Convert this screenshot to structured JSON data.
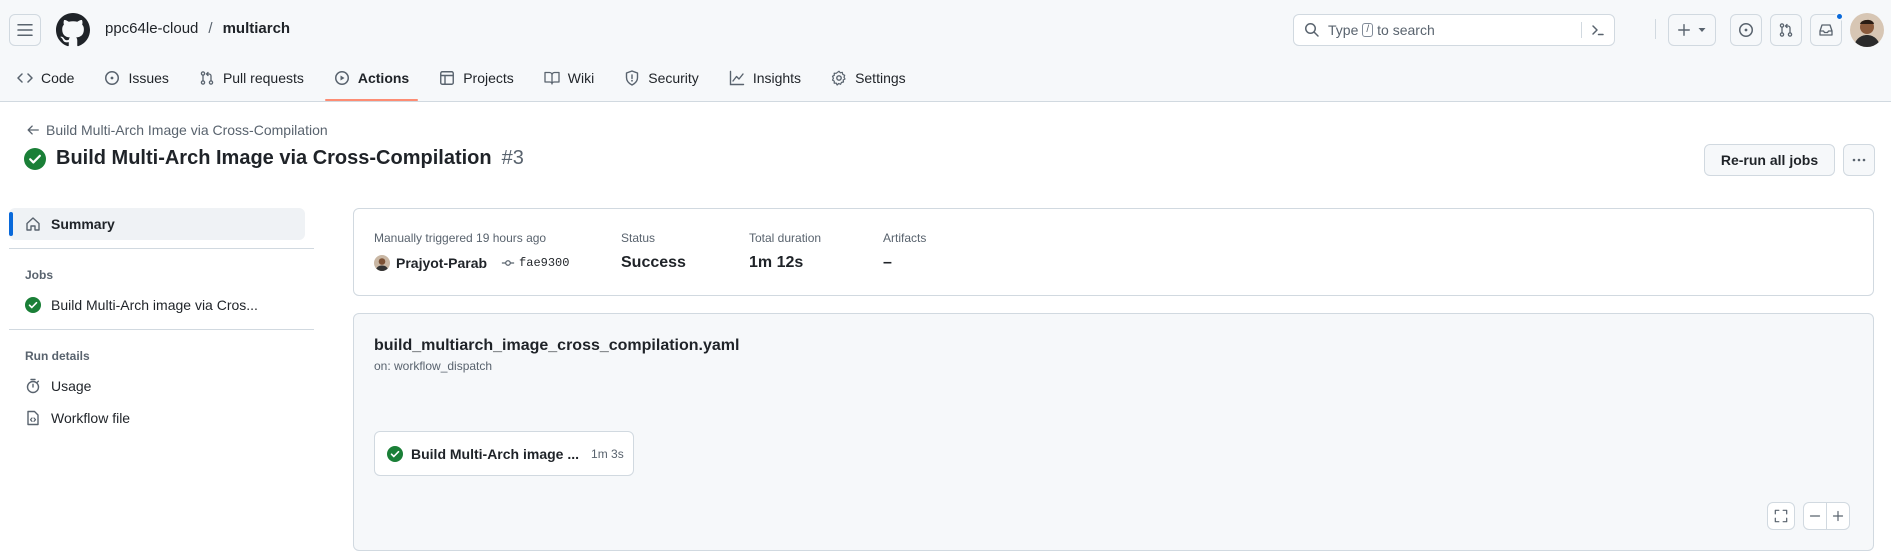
{
  "header": {
    "owner": "ppc64le-cloud",
    "separator": "/",
    "repo": "multiarch",
    "search_prefix": "Type",
    "search_key": "/",
    "search_suffix": "to search"
  },
  "tabs": [
    {
      "label": "Code",
      "icon": "code-icon"
    },
    {
      "label": "Issues",
      "icon": "issue-icon"
    },
    {
      "label": "Pull requests",
      "icon": "pull-request-icon"
    },
    {
      "label": "Actions",
      "icon": "play-icon",
      "active": true
    },
    {
      "label": "Projects",
      "icon": "table-icon"
    },
    {
      "label": "Wiki",
      "icon": "book-icon"
    },
    {
      "label": "Security",
      "icon": "shield-icon"
    },
    {
      "label": "Insights",
      "icon": "graph-icon"
    },
    {
      "label": "Settings",
      "icon": "gear-icon"
    }
  ],
  "run": {
    "back_label": "Build Multi-Arch Image via Cross-Compilation",
    "title": "Build Multi-Arch Image via Cross-Compilation",
    "number": "#3",
    "rerun_label": "Re-run all jobs"
  },
  "sidebar": {
    "summary_label": "Summary",
    "jobs_heading": "Jobs",
    "job_label": "Build Multi-Arch image via Cros...",
    "run_details_heading": "Run details",
    "usage_label": "Usage",
    "workflow_file_label": "Workflow file"
  },
  "summary": {
    "trigger_label": "Manually triggered 19 hours ago",
    "actor": "Prajyot-Parab",
    "commit": "fae9300",
    "status_label": "Status",
    "status_value": "Success",
    "duration_label": "Total duration",
    "duration_value": "1m 12s",
    "artifacts_label": "Artifacts",
    "artifacts_value": "–"
  },
  "graph": {
    "workflow_file": "build_multiarch_image_cross_compilation.yaml",
    "trigger": "on: workflow_dispatch",
    "job_name": "Build Multi-Arch image ...",
    "job_duration": "1m 3s"
  },
  "colors": {
    "success": "#1a7f37",
    "accent": "#0969da",
    "tab_underline": "#fd8c73"
  }
}
